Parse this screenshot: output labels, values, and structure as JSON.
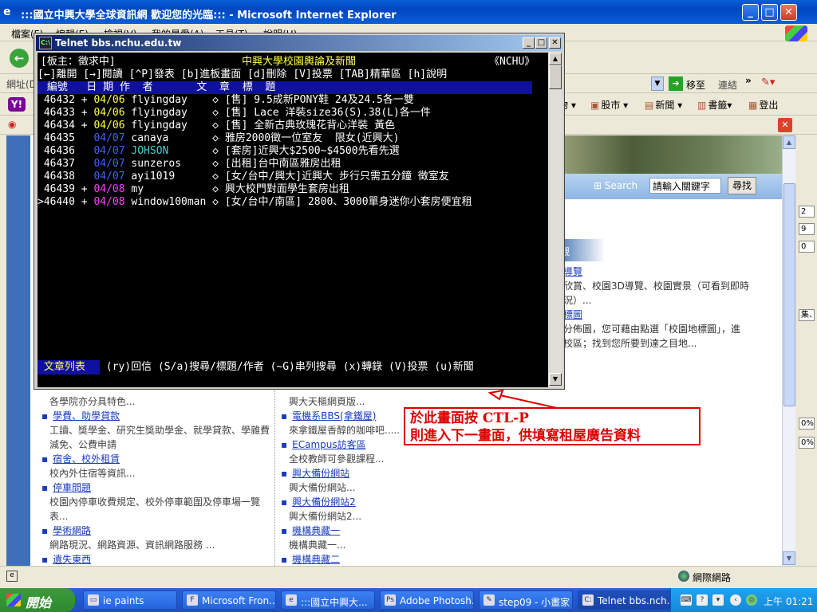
{
  "ie": {
    "title": ":::國立中興大學全球資訊網 歡迎您的光臨::: - Microsoft Internet Explorer",
    "menu": [
      "檔案(F)",
      "編輯(E)",
      "檢視(V)",
      "我的最愛(A)",
      "工具(T)",
      "說明(H)"
    ],
    "address_label": "網址(D)",
    "go_label": "移至",
    "links_label": "連結",
    "links_more": "»",
    "yahoo_items": [
      "股市",
      "新聞",
      "書籤",
      "登出"
    ],
    "status_zone": "網際網路"
  },
  "page": {
    "search_label": "Search",
    "search_placeholder": "請輸入關鍵字",
    "search_button": "尋找",
    "section_head": "觀",
    "right": [
      {
        "link": "導覽",
        "desc": [
          "欣賞、校園3D導覽、校園實景（可看到即時",
          "況）..."
        ]
      },
      {
        "link": "標圖",
        "desc": [
          "分佈圖，您可藉由點選「校園地標圖」，進",
          "校區；找到您所要到達之目地..."
        ]
      }
    ],
    "left": [
      {
        "desc": "各學院亦分具特色..."
      },
      {
        "link": "學費、助學貸款",
        "desc": "工讀、獎學金、研究生獎助學金、就學貸款、學雜費",
        "desc2": "減免、公費申請"
      },
      {
        "link": "宿舍、校外租賃",
        "desc": "校內外住宿等資訊..."
      },
      {
        "link": "停車問題",
        "desc": "校園內停車收費規定、校外停車範圍及停車場一覽",
        "desc2": "表..."
      },
      {
        "link": "學術網路",
        "desc": "網路現況、網路資源、資訊網路服務 ..."
      },
      {
        "link": "遺失東西"
      }
    ],
    "middle": [
      {
        "desc": "興大天樞網頁版..."
      },
      {
        "link": "電機系BBS(拿鐵屋)",
        "desc": "來拿鐵屋香醇的咖啡吧....."
      },
      {
        "link": "ECampus訪客區",
        "desc": "全校教師可參觀課程..."
      },
      {
        "link": "興大備份網站",
        "desc": "興大備份網站..."
      },
      {
        "link": "興大備份網站2",
        "desc": "興大備份網站2..."
      },
      {
        "link": "機構典藏一",
        "desc": "機構典藏一..."
      },
      {
        "link": "機構典藏二"
      }
    ],
    "right_strip": [
      "2",
      "9",
      "0",
      "集、",
      "0%",
      "0%"
    ]
  },
  "telnet": {
    "title": "Telnet bbs.nchu.edu.tw",
    "line1_left": "[板主：徵求中]",
    "line1_mid": "中興大學校園輿論及新聞",
    "line1_right": "《NCHU》",
    "line2": "[←]離開 [→]閱讀 [^P]發表 [b]進板畫面 [d]刪除 [V]投票 [TAB]精華區 [h]說明",
    "header": " 編號   日 期 作  者       文  章  標  題",
    "posts": [
      {
        "num": " 46432 + ",
        "date": "04/06",
        "author": " flyingday    ",
        "title": "◇ [售] 9.5成新PONY鞋 24及24.5各一雙",
        "date_color": "y",
        "author_color": "w"
      },
      {
        "num": " 46433 + ",
        "date": "04/06",
        "author": " flyingday    ",
        "title": "◇ [售] Lace 洋裝size36(S).38(L)各一件",
        "date_color": "y",
        "author_color": "w"
      },
      {
        "num": " 46434 + ",
        "date": "04/06",
        "author": " flyingday    ",
        "title": "◇ [售] 全新古典玫瑰花背心洋裝 黃色",
        "date_color": "y",
        "author_color": "w"
      },
      {
        "num": " 46435   ",
        "date": "04/07",
        "author": " canaya       ",
        "title": "◇ 雅房2000徵一位室友  限女(近興大)",
        "date_color": "b",
        "author_color": "w"
      },
      {
        "num": " 46436   ",
        "date": "04/07",
        "author": " JOHSON       ",
        "title": "◇ [套房]近興大$2500~$4500先看先選",
        "date_color": "b",
        "author_color": "c"
      },
      {
        "num": " 46437   ",
        "date": "04/07",
        "author": " sunzeros     ",
        "title": "◇ [出租]台中南區雅房出租",
        "date_color": "b",
        "author_color": "w"
      },
      {
        "num": " 46438   ",
        "date": "04/07",
        "author": " ayi1019      ",
        "title": "◇ [女/台中/興大]近興大 步行只需五分鐘 徵室友",
        "date_color": "b",
        "author_color": "w"
      },
      {
        "num": " 46439 + ",
        "date": "04/08",
        "author": " my           ",
        "title": "◇ 興大校門對面學生套房出租",
        "date_color": "m",
        "author_color": "w"
      },
      {
        "num": ">46440 + ",
        "date": "04/08",
        "author": " window100man ",
        "title": "◇ [女/台中/南區] 2800、3000單身迷你小套房便宜租",
        "date_color": "m",
        "author_color": "w"
      }
    ],
    "footer_label": " 文章列表 ",
    "footer_rest": " (ry)回信 (S/a)搜尋/標題/作者 (~G)串列搜尋 (x)轉錄 (V)投票 (u)新聞"
  },
  "annotation": {
    "line1": "於此畫面按 CTL-P",
    "line2": "則進入下一畫面，供填寫租屋廣告資料"
  },
  "taskbar": {
    "start": "開始",
    "tasks": [
      "ie paints",
      "Microsoft Fron...",
      ":::國立中興大...",
      "Adobe Photosh...",
      "step09 - 小畫家",
      "Telnet bbs.nch..."
    ],
    "clock": "上午 01:21"
  }
}
